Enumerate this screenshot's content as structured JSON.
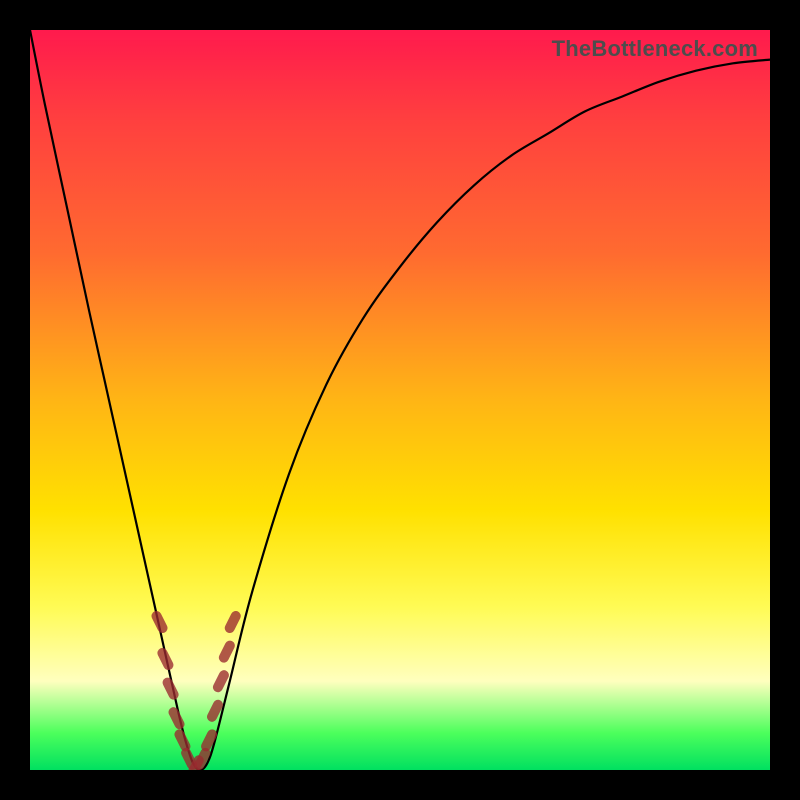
{
  "watermark": "TheBottleneck.com",
  "colors": {
    "frame": "#000000",
    "curve": "#000000",
    "bead": "#9a2a2f",
    "gradient_top": "#ff1a4d",
    "gradient_bottom": "#00e060"
  },
  "chart_data": {
    "type": "line",
    "title": "",
    "xlabel": "",
    "ylabel": "",
    "xlim": [
      0,
      100
    ],
    "ylim": [
      0,
      100
    ],
    "annotations": [
      "TheBottleneck.com"
    ],
    "series": [
      {
        "name": "bottleneck-curve",
        "x": [
          0,
          2,
          5,
          8,
          10,
          12,
          14,
          16,
          18,
          20,
          21,
          22,
          23,
          24,
          25,
          27,
          30,
          35,
          40,
          45,
          50,
          55,
          60,
          65,
          70,
          75,
          80,
          85,
          90,
          95,
          100
        ],
        "y": [
          100,
          90,
          76,
          62,
          53,
          44,
          35,
          26,
          17,
          8,
          4,
          1,
          0,
          1,
          4,
          12,
          24,
          40,
          52,
          61,
          68,
          74,
          79,
          83,
          86,
          89,
          91,
          93,
          94.5,
          95.5,
          96
        ]
      }
    ],
    "highlighted_points": {
      "name": "beads",
      "description": "salmon-colored markers near the curve minimum",
      "points": [
        {
          "x": 17.5,
          "y": 20
        },
        {
          "x": 18.3,
          "y": 15
        },
        {
          "x": 19.0,
          "y": 11
        },
        {
          "x": 19.8,
          "y": 7
        },
        {
          "x": 20.6,
          "y": 4
        },
        {
          "x": 21.5,
          "y": 1.5
        },
        {
          "x": 22.4,
          "y": 0.5
        },
        {
          "x": 23.3,
          "y": 1.5
        },
        {
          "x": 24.2,
          "y": 4
        },
        {
          "x": 25.0,
          "y": 8
        },
        {
          "x": 25.8,
          "y": 12
        },
        {
          "x": 26.6,
          "y": 16
        },
        {
          "x": 27.4,
          "y": 20
        }
      ]
    }
  }
}
